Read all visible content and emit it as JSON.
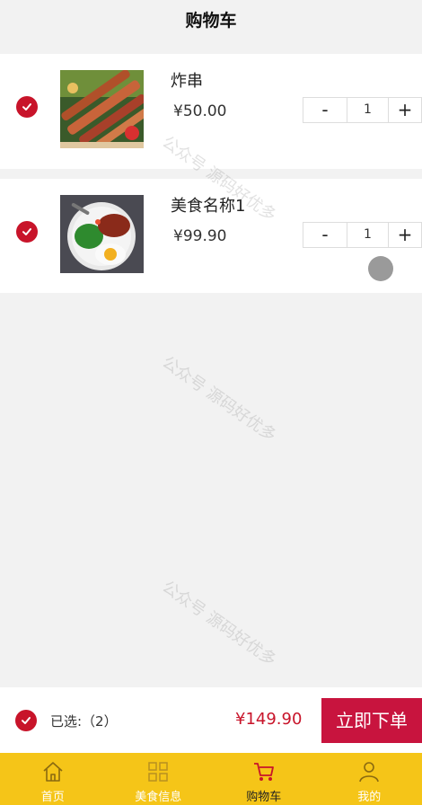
{
  "header": {
    "title": "购物车"
  },
  "items": [
    {
      "name": "炸串",
      "price": "¥50.00",
      "qty": "1",
      "minus": "-",
      "plus": "+"
    },
    {
      "name": "美食名称1",
      "price": "¥99.90",
      "qty": "1",
      "minus": "-",
      "plus": "+"
    }
  ],
  "footer": {
    "selected": "已选:（2）",
    "total": "¥149.90",
    "order_label": "立即下单"
  },
  "tabs": [
    {
      "label": "首页",
      "icon": "home-icon"
    },
    {
      "label": "美食信息",
      "icon": "grid-icon"
    },
    {
      "label": "购物车",
      "icon": "cart-icon"
    },
    {
      "label": "我的",
      "icon": "user-icon"
    }
  ],
  "watermark": "公众号 源码好优多",
  "colors": {
    "accent": "#c8142a",
    "tabbar": "#f5c518",
    "order_button": "#c8143e"
  }
}
